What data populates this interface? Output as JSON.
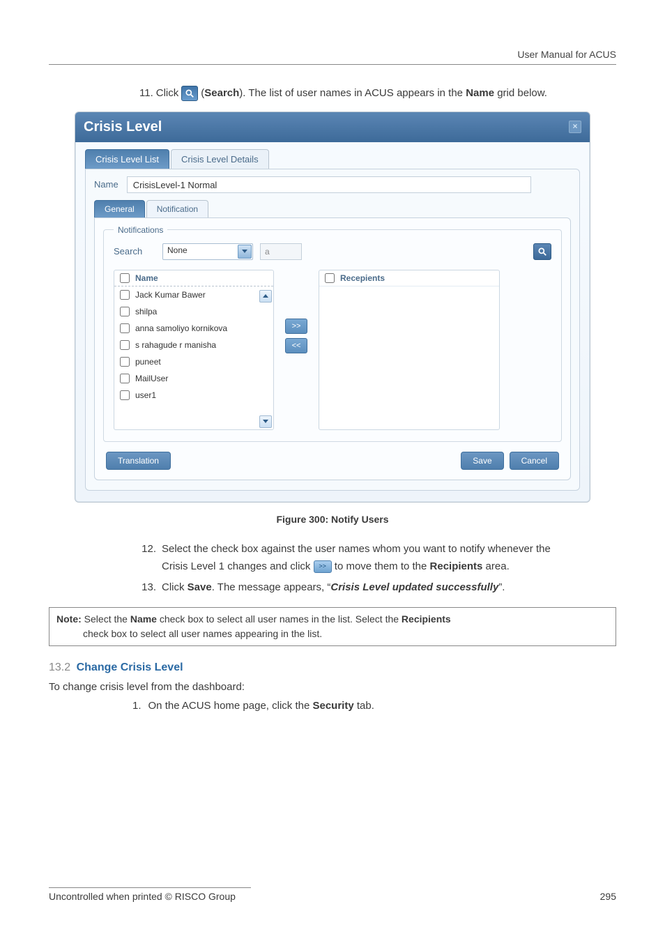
{
  "header": {
    "doc_title": "User Manual for ACUS"
  },
  "step11": {
    "num": "11.",
    "pre": "Click",
    "post": "(",
    "search_word": "Search",
    "tail": "). The list of user names in ACUS appears in the ",
    "name_bold": "Name",
    "tail2": " grid below."
  },
  "dialog": {
    "title": "Crisis Level",
    "tabs_outer": {
      "active": "Crisis Level List",
      "other": "Crisis Level Details"
    },
    "name_label": "Name",
    "name_value": "CrisisLevel-1  Normal",
    "tabs_inner": {
      "active": "General",
      "other": "Notification"
    },
    "fieldset_legend": "Notifications",
    "search": {
      "label": "Search",
      "select_value": "None",
      "small_input": "a"
    },
    "left_list": {
      "header": "Name",
      "rows": [
        "Jack Kumar Bawer",
        "shilpa",
        "anna samoliyo kornikova",
        "s rahagude r manisha",
        "puneet",
        "MailUser",
        "user1"
      ]
    },
    "transfer": {
      "to": ">>",
      "from": "<<"
    },
    "right_list": {
      "header": "Recepients"
    },
    "footer": {
      "translation": "Translation",
      "save": "Save",
      "cancel": "Cancel"
    }
  },
  "figure_caption": "Figure 300: Notify Users",
  "step12": {
    "num": "12.",
    "line1": "Select the check box against the user names whom you want to notify whenever the",
    "line2a": "Crisis Level 1 changes and click",
    "line2b": "to move them to the ",
    "recipients_bold": "Recipients",
    "line2c": " area."
  },
  "step13": {
    "num": "13.",
    "a": "Click ",
    "save_bold": "Save",
    "b": ". The message appears, “",
    "italic": "Crisis Level updated successfully",
    "c": "”."
  },
  "note": {
    "label": "Note:",
    "a": " Select the ",
    "name_bold": "Name",
    "b": " check box to select all user names in the list. Select the ",
    "recipients_bold": "Recipients",
    "c": " check box to select all user names appearing in the list."
  },
  "section": {
    "num": "13.2",
    "title": "Change Crisis Level",
    "intro": "To change crisis level from the dashboard:",
    "step1_num": "1.",
    "step1_a": "On the ACUS home page, click the ",
    "step1_bold": "Security",
    "step1_b": " tab."
  },
  "footer": {
    "left": "Uncontrolled when printed © RISCO Group",
    "right": "295"
  }
}
